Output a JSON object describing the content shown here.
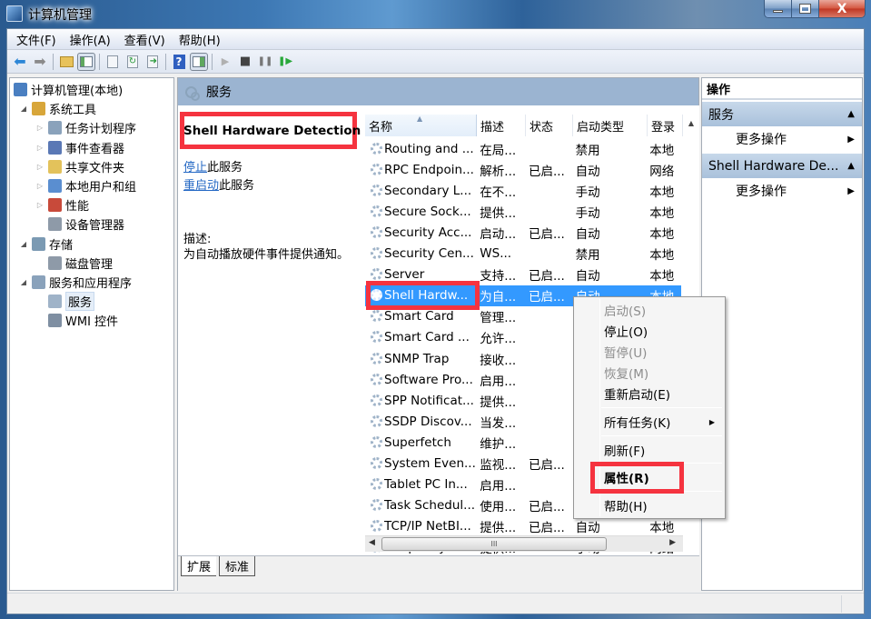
{
  "window": {
    "title": "计算机管理",
    "controls": {
      "minimize": "minimize",
      "maximize": "maximize",
      "close": "X"
    }
  },
  "menubar": [
    "文件(F)",
    "操作(A)",
    "查看(V)",
    "帮助(H)"
  ],
  "toolbar": {
    "buttons": [
      "back-arrow",
      "forward-arrow",
      "up-folder",
      "show-hide-console-tree",
      "export-list",
      "refresh",
      "export",
      "help",
      "show-hide-action-pane",
      "start-service",
      "stop-service",
      "pause-service",
      "restart-service"
    ],
    "glyphs": {
      "back": "⬅",
      "forward": "➡",
      "help": "?",
      "play": "▶",
      "stop": "■",
      "pause": "❚❚",
      "restart": "❚▶"
    }
  },
  "tree": {
    "items": [
      {
        "label": "计算机管理(本地)",
        "level": 0,
        "expander": "",
        "icon": "computer-management-icon",
        "color": "#4a7fc1"
      },
      {
        "label": "系统工具",
        "level": 1,
        "expander": "◢",
        "icon": "system-tools-icon",
        "color": "#d8a63a"
      },
      {
        "label": "任务计划程序",
        "level": 2,
        "expander": "▷",
        "icon": "task-scheduler-icon",
        "color": "#8aa2bb"
      },
      {
        "label": "事件查看器",
        "level": 2,
        "expander": "▷",
        "icon": "event-viewer-icon",
        "color": "#5a78b5"
      },
      {
        "label": "共享文件夹",
        "level": 2,
        "expander": "▷",
        "icon": "shared-folders-icon",
        "color": "#e3c25b"
      },
      {
        "label": "本地用户和组",
        "level": 2,
        "expander": "▷",
        "icon": "local-users-icon",
        "color": "#5a8ed0"
      },
      {
        "label": "性能",
        "level": 2,
        "expander": "▷",
        "icon": "performance-icon",
        "color": "#c84a3a"
      },
      {
        "label": "设备管理器",
        "level": 2,
        "expander": "",
        "icon": "device-manager-icon",
        "color": "#8e9aa8"
      },
      {
        "label": "存储",
        "level": 1,
        "expander": "◢",
        "icon": "storage-icon",
        "color": "#7b9ab3"
      },
      {
        "label": "磁盘管理",
        "level": 2,
        "expander": "",
        "icon": "disk-management-icon",
        "color": "#8e9aa8"
      },
      {
        "label": "服务和应用程序",
        "level": 1,
        "expander": "◢",
        "icon": "services-applications-icon",
        "color": "#8aa2bb"
      },
      {
        "label": "服务",
        "level": 2,
        "expander": "",
        "icon": "services-icon",
        "color": "#9fb3c8",
        "selected": true
      },
      {
        "label": "WMI 控件",
        "level": 2,
        "expander": "",
        "icon": "wmi-control-icon",
        "color": "#7f8fa2"
      }
    ]
  },
  "services_pane": {
    "header": "服务",
    "detail": {
      "service_name": "Shell Hardware Detection",
      "stop_link": "停止",
      "stop_suffix": "此服务",
      "restart_link": "重启动",
      "restart_suffix": "此服务",
      "description_label": "描述:",
      "description": "为自动播放硬件事件提供通知。"
    },
    "columns": [
      "名称",
      "描述",
      "状态",
      "启动类型",
      "登录"
    ],
    "rows": [
      {
        "name": "Routing and ...",
        "desc": "在局...",
        "status": "",
        "startup": "禁用",
        "logon": "本地"
      },
      {
        "name": "RPC Endpoin...",
        "desc": "解析...",
        "status": "已启...",
        "startup": "自动",
        "logon": "网络"
      },
      {
        "name": "Secondary L...",
        "desc": "在不...",
        "status": "",
        "startup": "手动",
        "logon": "本地"
      },
      {
        "name": "Secure Sock...",
        "desc": "提供...",
        "status": "",
        "startup": "手动",
        "logon": "本地"
      },
      {
        "name": "Security Acc...",
        "desc": "启动...",
        "status": "已启...",
        "startup": "自动",
        "logon": "本地"
      },
      {
        "name": "Security Cen...",
        "desc": "WS...",
        "status": "",
        "startup": "禁用",
        "logon": "本地"
      },
      {
        "name": "Server",
        "desc": "支持...",
        "status": "已启...",
        "startup": "自动",
        "logon": "本地"
      },
      {
        "name": "Shell Hardw...",
        "desc": "为自...",
        "status": "已启...",
        "startup": "自动",
        "logon": "本地",
        "selected": true
      },
      {
        "name": "Smart Card",
        "desc": "管理...",
        "status": "",
        "startup": "",
        "logon": ""
      },
      {
        "name": "Smart Card ...",
        "desc": "允许...",
        "status": "",
        "startup": "",
        "logon": ""
      },
      {
        "name": "SNMP Trap",
        "desc": "接收...",
        "status": "",
        "startup": "",
        "logon": ""
      },
      {
        "name": "Software Pro...",
        "desc": "启用...",
        "status": "",
        "startup": "",
        "logon": ""
      },
      {
        "name": "SPP Notificat...",
        "desc": "提供...",
        "status": "",
        "startup": "",
        "logon": ""
      },
      {
        "name": "SSDP Discov...",
        "desc": "当发...",
        "status": "",
        "startup": "",
        "logon": ""
      },
      {
        "name": "Superfetch",
        "desc": "维护...",
        "status": "",
        "startup": "",
        "logon": ""
      },
      {
        "name": "System Even...",
        "desc": "监视...",
        "status": "已启...",
        "startup": "",
        "logon": ""
      },
      {
        "name": "Tablet PC In...",
        "desc": "启用...",
        "status": "",
        "startup": "",
        "logon": ""
      },
      {
        "name": "Task Schedul...",
        "desc": "使用...",
        "status": "已启...",
        "startup": "",
        "logon": ""
      },
      {
        "name": "TCP/IP NetBI...",
        "desc": "提供...",
        "status": "已启...",
        "startup": "自动",
        "logon": "本地"
      },
      {
        "name": "Telephony",
        "desc": "提供...",
        "status": "",
        "startup": "手动",
        "logon": "网络"
      }
    ],
    "hscroll_grip": "III",
    "tabs": [
      "扩展",
      "标准"
    ]
  },
  "context_menu": {
    "items": [
      {
        "label": "启动(S)",
        "disabled": true
      },
      {
        "label": "停止(O)",
        "disabled": false
      },
      {
        "label": "暂停(U)",
        "disabled": true
      },
      {
        "label": "恢复(M)",
        "disabled": true
      },
      {
        "label": "重新启动(E)",
        "disabled": false
      },
      {
        "label": "所有任务(K)",
        "disabled": false,
        "submenu": true
      },
      {
        "label": "刷新(F)",
        "disabled": false
      },
      {
        "label": "属性(R)",
        "disabled": false,
        "bold": true
      },
      {
        "label": "帮助(H)",
        "disabled": false
      }
    ]
  },
  "actions": {
    "title": "操作",
    "sections": [
      {
        "label": "服务",
        "items": [
          "更多操作"
        ]
      },
      {
        "label": "Shell Hardware De...",
        "items": [
          "更多操作"
        ]
      }
    ]
  },
  "highlight_color": "#f5333f",
  "selection_color": "#3399ff"
}
